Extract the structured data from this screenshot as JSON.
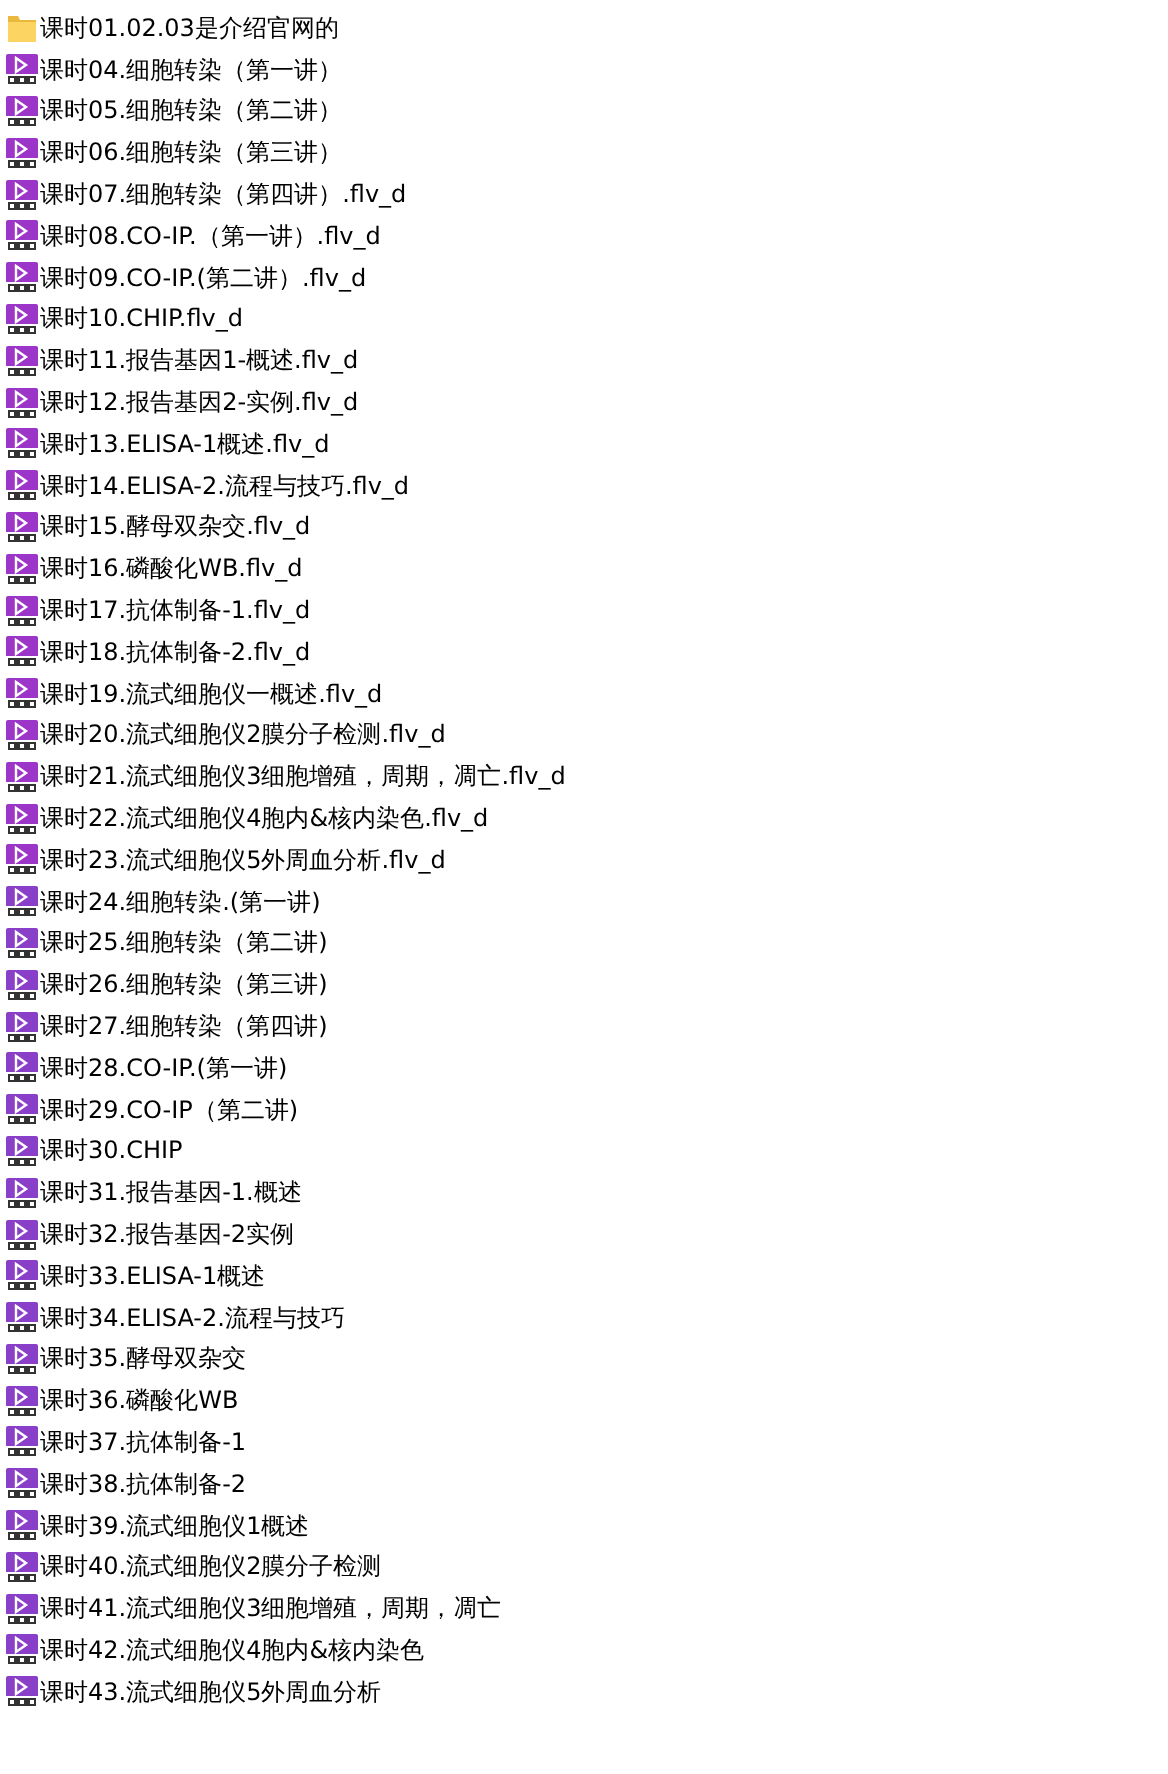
{
  "files": [
    {
      "kind": "folder",
      "name": "课时01.02.03是介绍官网的"
    },
    {
      "kind": "flv",
      "name": "课时04.细胞转染（第一讲）"
    },
    {
      "kind": "flv",
      "name": "课时05.细胞转染（第二讲）"
    },
    {
      "kind": "flv",
      "name": "课时06.细胞转染（第三讲）"
    },
    {
      "kind": "flv",
      "name": "课时07.细胞转染（第四讲）.flv_d"
    },
    {
      "kind": "flv",
      "name": "课时08.CO-IP.（第一讲）.flv_d"
    },
    {
      "kind": "flv",
      "name": "课时09.CO-IP.(第二讲）.flv_d"
    },
    {
      "kind": "flv",
      "name": "课时10.CHIP.flv_d"
    },
    {
      "kind": "flv",
      "name": "课时11.报告基因1-概述.flv_d"
    },
    {
      "kind": "flv",
      "name": "课时12.报告基因2-实例.flv_d"
    },
    {
      "kind": "flv",
      "name": "课时13.ELISA-1概述.flv_d"
    },
    {
      "kind": "flv",
      "name": "课时14.ELISA-2.流程与技巧.flv_d"
    },
    {
      "kind": "flv",
      "name": "课时15.酵母双杂交.flv_d"
    },
    {
      "kind": "flv",
      "name": "课时16.磷酸化WB.flv_d"
    },
    {
      "kind": "flv",
      "name": "课时17.抗体制备-1.flv_d"
    },
    {
      "kind": "flv",
      "name": "课时18.抗体制备-2.flv_d"
    },
    {
      "kind": "flv",
      "name": "课时19.流式细胞仪一概述.flv_d"
    },
    {
      "kind": "flv",
      "name": "课时20.流式细胞仪2膜分子检测.flv_d"
    },
    {
      "kind": "flv",
      "name": "课时21.流式细胞仪3细胞增殖，周期，凋亡.flv_d"
    },
    {
      "kind": "flv",
      "name": "课时22.流式细胞仪4胞内&核内染色.flv_d"
    },
    {
      "kind": "flv",
      "name": "课时23.流式细胞仪5外周血分析.flv_d"
    },
    {
      "kind": "swf",
      "name": "课时24.细胞转染.(第一讲)"
    },
    {
      "kind": "swf",
      "name": "课时25.细胞转染（第二讲)"
    },
    {
      "kind": "swf",
      "name": "课时26.细胞转染（第三讲)"
    },
    {
      "kind": "swf",
      "name": "课时27.细胞转染（第四讲)"
    },
    {
      "kind": "swf",
      "name": "课时28.CO-IP.(第一讲)"
    },
    {
      "kind": "swf",
      "name": "课时29.CO-IP（第二讲)"
    },
    {
      "kind": "swf",
      "name": "课时30.CHIP"
    },
    {
      "kind": "swf",
      "name": "课时31.报告基因-1.概述"
    },
    {
      "kind": "swf",
      "name": "课时32.报告基因-2实例"
    },
    {
      "kind": "swf",
      "name": "课时33.ELISA-1概述"
    },
    {
      "kind": "swf",
      "name": "课时34.ELISA-2.流程与技巧"
    },
    {
      "kind": "swf",
      "name": "课时35.酵母双杂交"
    },
    {
      "kind": "swf",
      "name": "课时36.磷酸化WB"
    },
    {
      "kind": "swf",
      "name": "课时37.抗体制备-1"
    },
    {
      "kind": "swf",
      "name": "课时38.抗体制备-2"
    },
    {
      "kind": "swf",
      "name": "课时39.流式细胞仪1概述"
    },
    {
      "kind": "swf",
      "name": "课时40.流式细胞仪2膜分子检测"
    },
    {
      "kind": "swf",
      "name": "课时41.流式细胞仪3细胞增殖，周期，凋亡"
    },
    {
      "kind": "swf",
      "name": "课时42.流式细胞仪4胞内&核内染色"
    },
    {
      "kind": "swf",
      "name": "课时43.流式细胞仪5外周血分析"
    }
  ]
}
